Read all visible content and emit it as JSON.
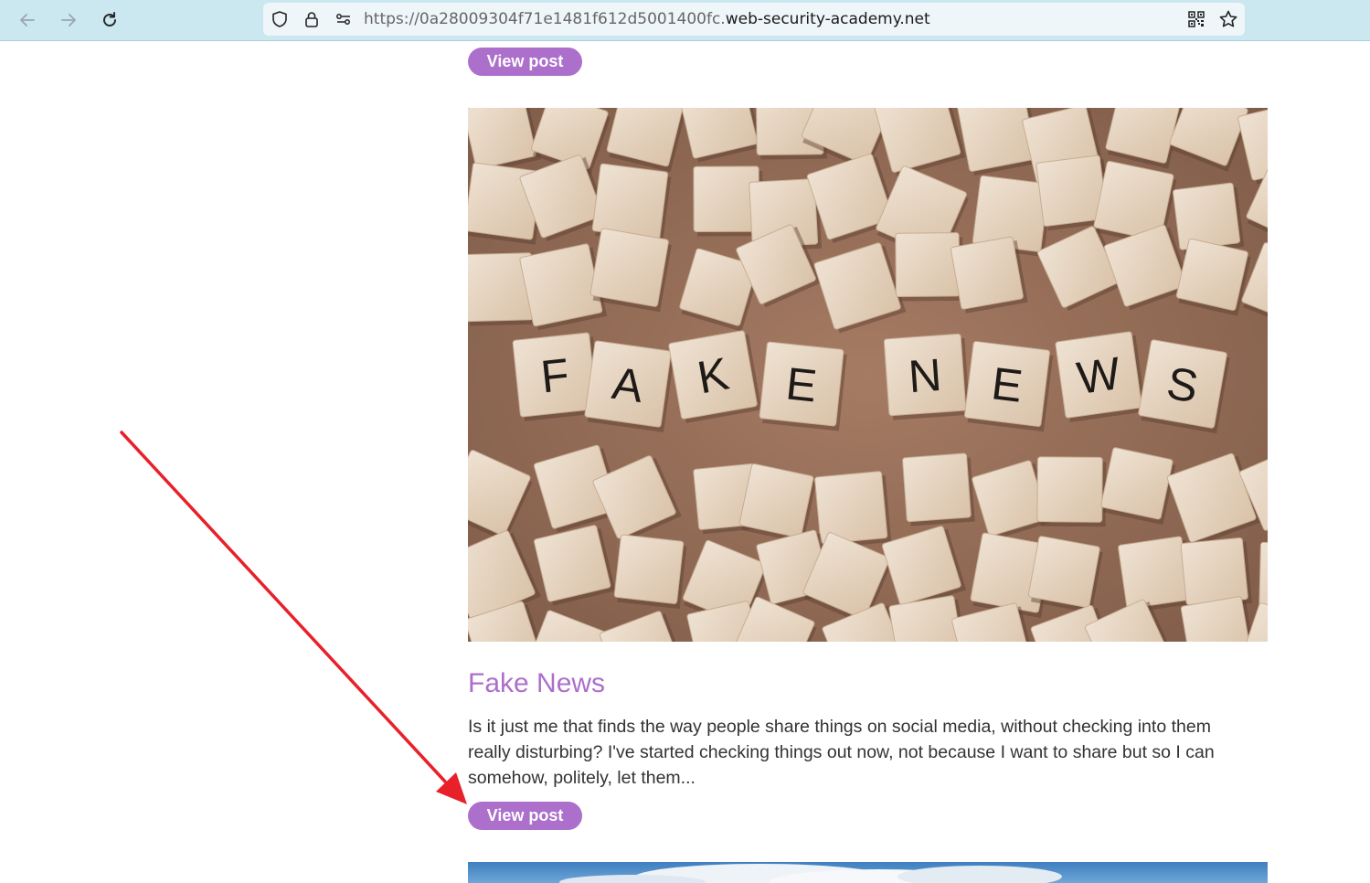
{
  "browser": {
    "url_prefix": "https://0a28009304f71e1481f612d5001400fc.",
    "url_domain": "web-security-academy.net",
    "icons": [
      "back-arrow-icon",
      "forward-arrow-icon",
      "reload-icon",
      "shield-icon",
      "lock-icon",
      "permissions-icon",
      "qr-code-icon",
      "star-icon"
    ]
  },
  "posts": [
    {
      "button_label": "View post"
    },
    {
      "image_tiles_text": "FAKENEWS",
      "title": "Fake News",
      "excerpt": "Is it just me that finds the way people share things on social media, without checking into them really disturbing? I've started checking things out now, not because I want to share but so I can somehow, politely, let them...",
      "button_label": "View post"
    }
  ],
  "annotation": {
    "type": "arrow",
    "color": "#e8202a"
  },
  "colors": {
    "accent": "#ac6fcb",
    "browser_bar": "#cbe7f0",
    "text": "#333333"
  }
}
